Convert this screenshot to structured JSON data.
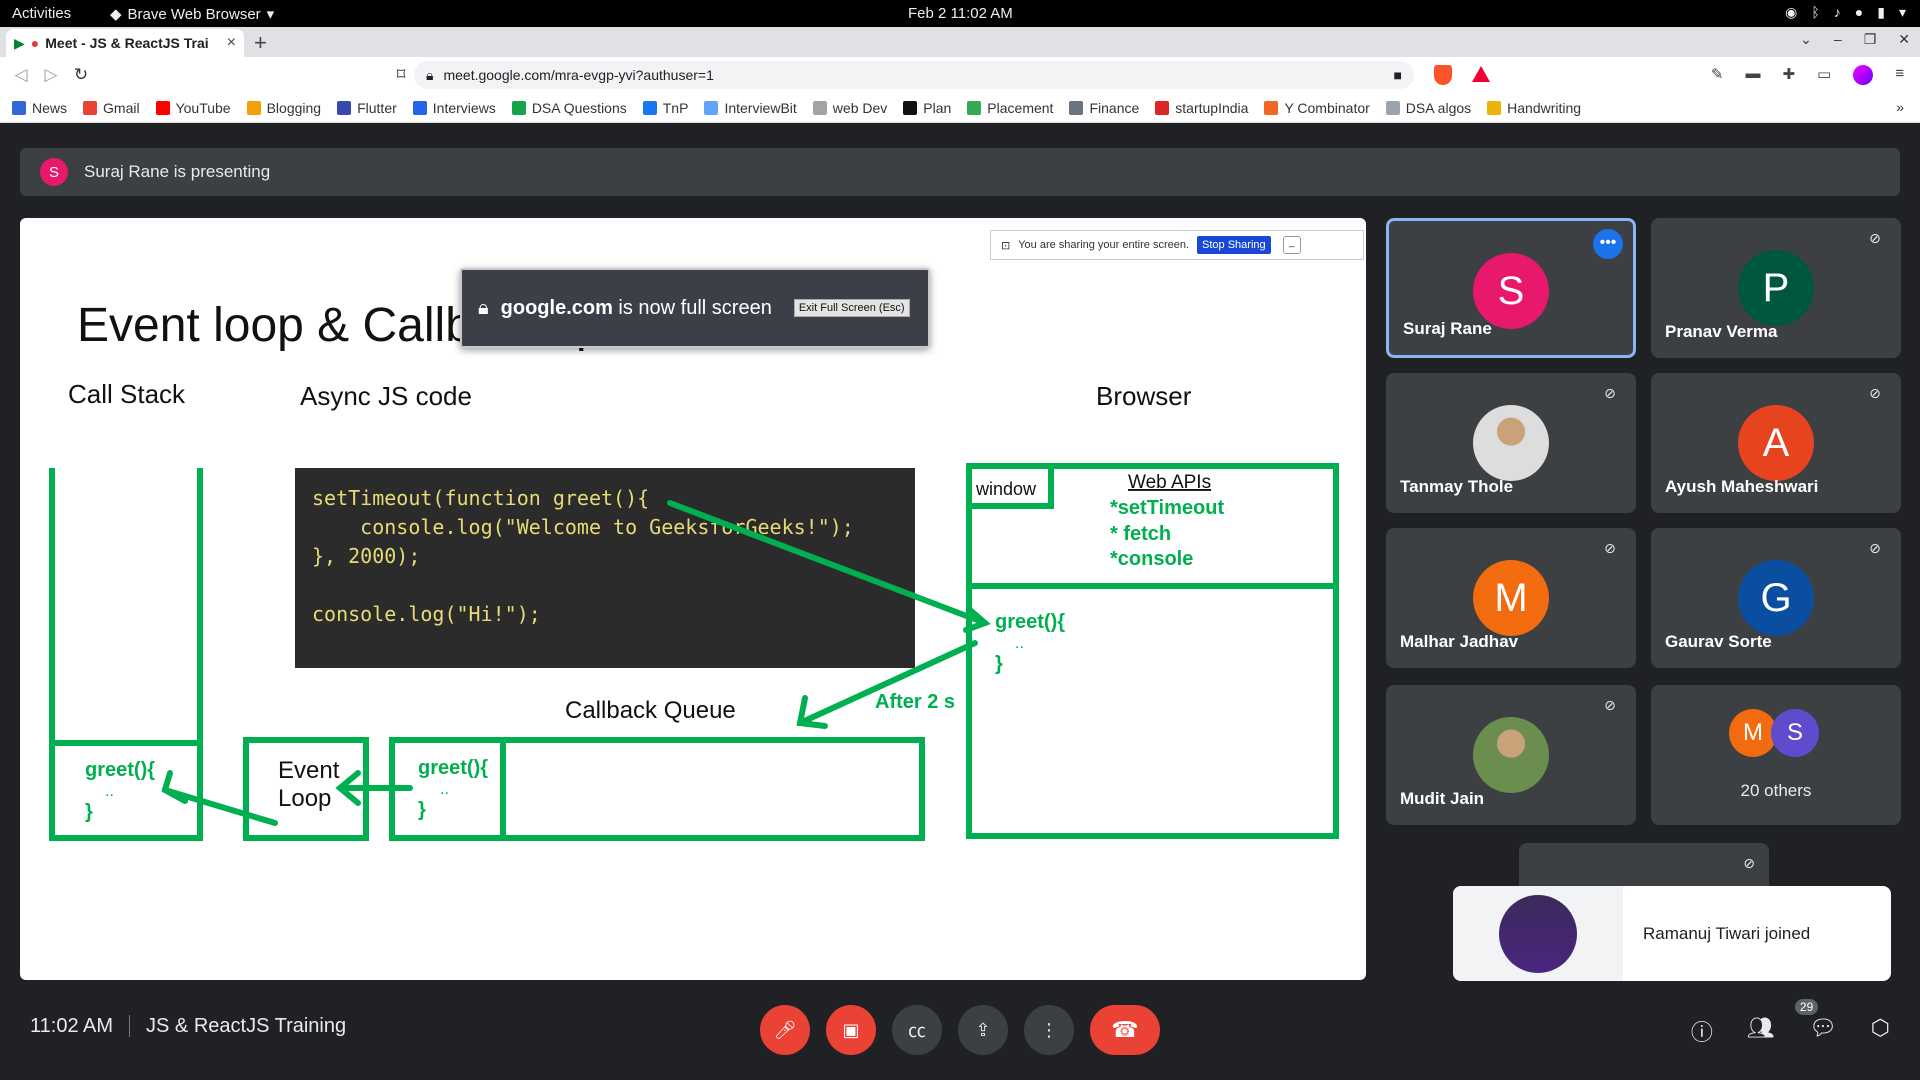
{
  "topbar": {
    "activities": "Activities",
    "app_name": "Brave Web Browser",
    "clock": "Feb 2  11:02 AM"
  },
  "browser": {
    "tab_title": "Meet - JS & ReactJS Trai",
    "url": "meet.google.com/mra-evgp-yvi?authuser=1",
    "bookmarks": [
      {
        "label": "News",
        "color": "#3367d6"
      },
      {
        "label": "Gmail",
        "color": "#ea4335"
      },
      {
        "label": "YouTube",
        "color": "#ff0000"
      },
      {
        "label": "Blogging",
        "color": "#f59e0b"
      },
      {
        "label": "Flutter",
        "color": "#3949ab"
      },
      {
        "label": "Interviews",
        "color": "#2563eb"
      },
      {
        "label": "DSA Questions",
        "color": "#16a34a"
      },
      {
        "label": "TnP",
        "color": "#1877f2"
      },
      {
        "label": "InterviewBit",
        "color": "#60a5fa"
      },
      {
        "label": "web Dev",
        "color": "#a3a3a3"
      },
      {
        "label": "Plan",
        "color": "#111111"
      },
      {
        "label": "Placement",
        "color": "#34a853"
      },
      {
        "label": "Finance",
        "color": "#6b7280"
      },
      {
        "label": "startupIndia",
        "color": "#dc2626"
      },
      {
        "label": "Y Combinator",
        "color": "#f26522"
      },
      {
        "label": "DSA algos",
        "color": "#9ca3af"
      },
      {
        "label": "Handwriting",
        "color": "#eab308"
      }
    ]
  },
  "meet": {
    "presenting_initial": "S",
    "presenting_text": "Suraj Rane is presenting",
    "slide": {
      "share_notice": "You are sharing your entire screen.",
      "stop_sharing": "Stop Sharing",
      "fullscreen_domain": "google.com",
      "fullscreen_text": " is now full screen",
      "exit_fullscreen": "Exit Full Screen (Esc)",
      "title": "Event loop & Callback queue",
      "call_stack": "Call Stack",
      "async_code": "Async JS code",
      "browser": "Browser",
      "window": "window",
      "web_apis": "Web APIs",
      "api_items": [
        "*setTimeout",
        "* fetch",
        "*console"
      ],
      "code_lines": [
        "setTimeout(function greet(){",
        "    console.log(\"Welcome to GeeksforGeeks!\");",
        "}, 2000);",
        "",
        "console.log(\"Hi!\");"
      ],
      "callback_queue": "Callback Queue",
      "after": "After 2 s",
      "event_loop": [
        "Event",
        "Loop"
      ],
      "greet": "greet(){",
      "dots": "..",
      "brace": "}"
    },
    "participants": [
      {
        "name": "Suraj Rane",
        "initial": "S",
        "color": "#e8186c"
      },
      {
        "name": "Pranav Verma",
        "initial": "P",
        "color": "#00573f"
      },
      {
        "name": "Tanmay Thole",
        "initial": "",
        "color": "#dddddd"
      },
      {
        "name": "Ayush Maheshwari",
        "initial": "A",
        "color": "#e8431f"
      },
      {
        "name": "Malhar Jadhav",
        "initial": "M",
        "color": "#f26b0f"
      },
      {
        "name": "Gaurav Sorte",
        "initial": "G",
        "color": "#0a4ea2"
      },
      {
        "name": "Mudit Jain",
        "initial": "",
        "color": "#6b8e4e"
      }
    ],
    "others": {
      "initials": [
        "M",
        "S"
      ],
      "colors": [
        "#f26b0f",
        "#5e4bcd"
      ],
      "label": "20 others"
    },
    "toast": "Ramanuj Tiwari joined",
    "bottom": {
      "time": "11:02 AM",
      "meeting_name": "JS & ReactJS Training",
      "people_count": "29"
    }
  }
}
